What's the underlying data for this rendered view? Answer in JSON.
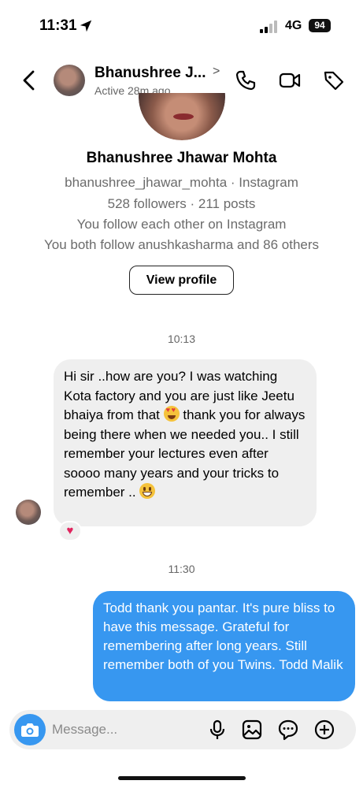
{
  "status_bar": {
    "time": "11:31",
    "network": "4G",
    "battery": "94"
  },
  "header": {
    "name": "Bhanushree J...",
    "chevron": ">",
    "active_status": "Active 28m ago",
    "icons": [
      "back-icon",
      "phone-icon",
      "video-camera-icon",
      "tag-icon"
    ]
  },
  "profile": {
    "full_name": "Bhanushree Jhawar Mohta",
    "username_line": "bhanushree_jhawar_mohta · Instagram",
    "stats": "528 followers · 211 posts",
    "follow_status": "You follow each other on Instagram",
    "mutual": "You both follow anushkasharma and 86 others",
    "view_profile_label": "View profile"
  },
  "messages": {
    "time_1": "10:13",
    "incoming_part1": "Hi sir ..how are you? I was watching Kota factory and you are just like Jeetu bhaiya from that ",
    "incoming_part2": " thank you for always being there when we needed you.. I still remember your lectures even after soooo many years and your tricks to remember .. ",
    "incoming_emoji_1": "heart-eyes-emoji",
    "incoming_emoji_2": "grinning-emoji",
    "reaction": "♥",
    "time_2": "11:30",
    "outgoing": "Todd thank you pantar. It's pure bliss to have this message. Grateful for remembering after long years. Still remember both of you Twins. Todd Malik"
  },
  "composer": {
    "placeholder": "Message...",
    "icons": [
      "camera-icon",
      "microphone-icon",
      "gallery-icon",
      "sticker-icon",
      "plus-icon"
    ]
  },
  "colors": {
    "accent_blue": "#3797f0",
    "incoming_bubble": "#efefef",
    "secondary_text": "#6b6b6b"
  }
}
